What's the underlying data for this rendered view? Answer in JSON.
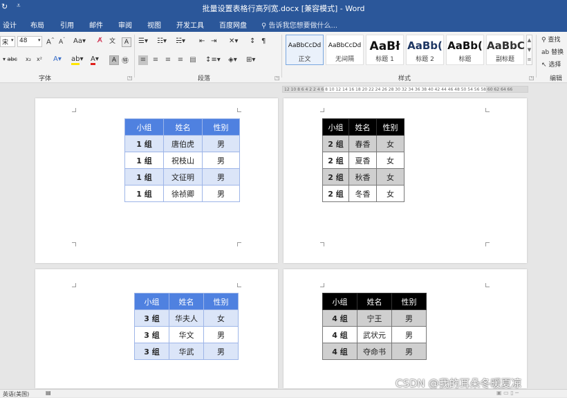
{
  "window": {
    "title": "批量设置表格行高列宽.docx [兼容模式] - Word"
  },
  "tabs": [
    "设计",
    "布局",
    "引用",
    "邮件",
    "审阅",
    "视图",
    "开发工具",
    "百度网盘"
  ],
  "tell_me": "告诉我您想要做什么...",
  "ribbon": {
    "font": {
      "name": "宋",
      "size": "48",
      "group_label": "字体"
    },
    "paragraph": {
      "group_label": "段落"
    },
    "styles": {
      "group_label": "样式",
      "items": [
        {
          "sample": "AaBbCcDd",
          "name": "正文"
        },
        {
          "sample": "AaBbCcDd",
          "name": "无间隔"
        },
        {
          "sample": "AaBł",
          "name": "标题 1"
        },
        {
          "sample": "AaBb(",
          "name": "标题 2"
        },
        {
          "sample": "AaBb(",
          "name": "标题"
        },
        {
          "sample": "AaBbC",
          "name": "副标题"
        }
      ]
    },
    "editing": {
      "group_label": "编辑",
      "find": "查找",
      "replace": "替换",
      "select": "选择"
    }
  },
  "ruler": {
    "text": "12 10  8  6  4  2     2  4  6  8 10 12 14 16 18 20 22 24 26 28 30 32 34 36 38 40 42 44 46 48 50    54 56 58 60 62 64 66"
  },
  "pages": [
    {
      "headers": [
        "小组",
        "姓名",
        "性别"
      ],
      "rows": [
        [
          "1 组",
          "唐伯虎",
          "男"
        ],
        [
          "1 组",
          "祝枝山",
          "男"
        ],
        [
          "1 组",
          "文征明",
          "男"
        ],
        [
          "1 组",
          "徐祯卿",
          "男"
        ]
      ]
    },
    {
      "headers": [
        "小组",
        "姓名",
        "性别"
      ],
      "rows": [
        [
          "2 组",
          "春香",
          "女"
        ],
        [
          "2 组",
          "夏香",
          "女"
        ],
        [
          "2 组",
          "秋香",
          "女"
        ],
        [
          "2 组",
          "冬香",
          "女"
        ]
      ]
    },
    {
      "headers": [
        "小组",
        "姓名",
        "性别"
      ],
      "rows": [
        [
          "3 组",
          "华夫人",
          "女"
        ],
        [
          "3 组",
          "华文",
          "男"
        ],
        [
          "3 组",
          "华武",
          "男"
        ]
      ]
    },
    {
      "headers": [
        "小组",
        "姓名",
        "性别"
      ],
      "rows": [
        [
          "4 组",
          "宁王",
          "男"
        ],
        [
          "4 组",
          "武状元",
          "男"
        ],
        [
          "4 组",
          "夺命书",
          "男"
        ]
      ]
    }
  ],
  "status": {
    "language": "英语(美国)"
  },
  "watermark": "CSDN @我的耳朵冬暖夏凉"
}
